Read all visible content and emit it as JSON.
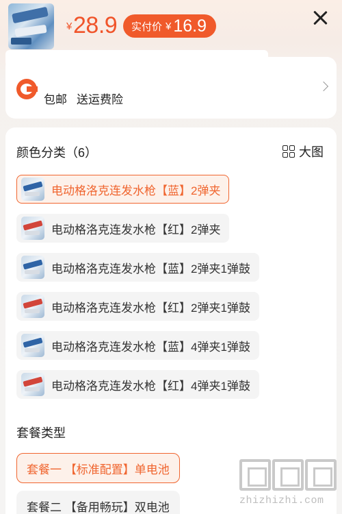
{
  "header": {
    "price_currency": "¥",
    "price": "28.9",
    "paid_label": "实付价",
    "paid_currency": "¥",
    "paid_price": "16.9"
  },
  "shipping": {
    "free_shipping": "包邮",
    "insurance": "送运费险"
  },
  "colors": {
    "title": "颜色分类（6）",
    "big_view_label": "大图",
    "items": [
      {
        "label": "电动格洛克连发水枪【蓝】2弹夹",
        "selected": true,
        "swatch": "blue"
      },
      {
        "label": "电动格洛克连发水枪【红】2弹夹",
        "selected": false,
        "swatch": "red"
      },
      {
        "label": "电动格洛克连发水枪【蓝】2弹夹1弹鼓",
        "selected": false,
        "swatch": "blue"
      },
      {
        "label": "电动格洛克连发水枪【红】2弹夹1弹鼓",
        "selected": false,
        "swatch": "red"
      },
      {
        "label": "电动格洛克连发水枪【蓝】4弹夹1弹鼓",
        "selected": false,
        "swatch": "blue"
      },
      {
        "label": "电动格洛克连发水枪【红】4弹夹1弹鼓",
        "selected": false,
        "swatch": "red"
      }
    ]
  },
  "packages": {
    "title": "套餐类型",
    "items": [
      {
        "label": "套餐一 【标准配置】单电池",
        "selected": true
      },
      {
        "label": "套餐二 【备用畅玩】双电池",
        "selected": false
      }
    ]
  },
  "watermark": {
    "text": "zhizhizhi.com"
  },
  "theme": {
    "accent": "#f05a2b",
    "selected_bg": "#fdf1ea"
  }
}
